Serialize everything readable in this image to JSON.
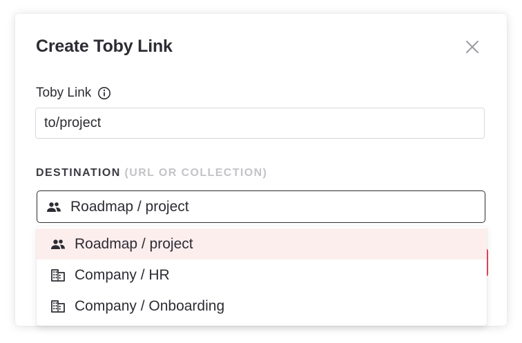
{
  "dialog": {
    "title": "Create Toby Link",
    "close_icon": "close-icon"
  },
  "toby_link": {
    "label": "Toby Link",
    "info_icon": "info-icon",
    "value": "to/project"
  },
  "destination": {
    "label": "DESTINATION",
    "hint": "(URL OR COLLECTION)",
    "selected_value": "Roadmap / project",
    "selected_icon": "team-icon",
    "options": [
      {
        "label": "Roadmap / project",
        "icon": "team-icon",
        "highlighted": true
      },
      {
        "label": "Company / HR",
        "icon": "building-icon",
        "highlighted": false
      },
      {
        "label": "Company / Onboarding",
        "icon": "building-icon",
        "highlighted": false
      }
    ]
  },
  "colors": {
    "text": "#2c2c33",
    "muted": "#c3c3c8",
    "highlight_bg": "#fdeeee",
    "accent": "#e8475b"
  }
}
